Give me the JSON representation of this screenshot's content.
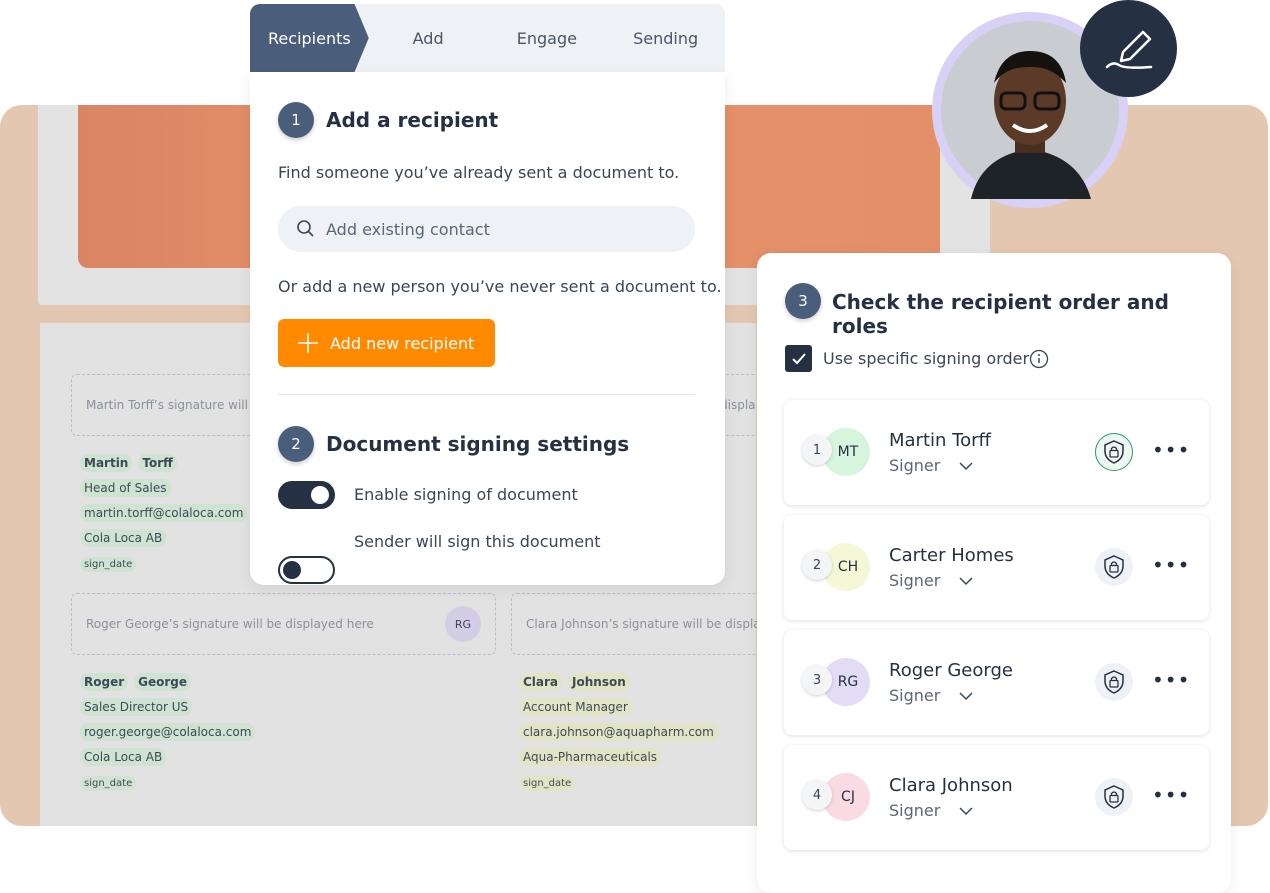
{
  "stepper": {
    "steps": [
      "Recipients",
      "Add",
      "Engage",
      "Sending"
    ],
    "active": 0
  },
  "section1": {
    "number": "1",
    "title": "Add a recipient",
    "desc": "Find someone you’ve already sent a document to.",
    "search_placeholder": "Add existing contact",
    "alt_desc": "Or add a new person you’ve never sent a document to.",
    "add_button": "Add new recipient"
  },
  "section2": {
    "number": "2",
    "title": "Document signing settings",
    "toggles": [
      {
        "label": "Enable signing of document",
        "on": true
      },
      {
        "label": "Sender will sign this document",
        "on": false
      }
    ]
  },
  "section3": {
    "number": "3",
    "title": "Check the recipient order and roles",
    "signing_order_label": "Use specific signing order",
    "signing_order_checked": true,
    "recipients": [
      {
        "order": "1",
        "initials": "MT",
        "name": "Martin Torff",
        "role": "Signer",
        "avatar_color": "#d6f5dc",
        "lock_active": true
      },
      {
        "order": "2",
        "initials": "CH",
        "name": "Carter Homes",
        "role": "Signer",
        "avatar_color": "#f4f8d6",
        "lock_active": false
      },
      {
        "order": "3",
        "initials": "RG",
        "name": "Roger George",
        "role": "Signer",
        "avatar_color": "#e3dcf7",
        "lock_active": false
      },
      {
        "order": "4",
        "initials": "CJ",
        "name": "Clara Johnson",
        "role": "Signer",
        "avatar_color": "#fadbe3",
        "lock_active": false
      }
    ]
  },
  "document": {
    "sig1": "Martin Torff’s signature will be displayed here",
    "sig1_right": "displa",
    "sig2": "Roger George’s signature will be displayed here",
    "sig2_initials": "RG",
    "sig3": "Clara Johnson’s signature will be displayed here",
    "martin": {
      "first": "Martin",
      "last": "Torff",
      "title": "Head of Sales",
      "email": "martin.torff@colaloca.com",
      "company": "Cola Loca AB",
      "date": "sign_date"
    },
    "roger": {
      "first": "Roger",
      "last": "George",
      "title": "Sales Director US",
      "email": "roger.george@colaloca.com",
      "company": "Cola Loca AB",
      "date": "sign_date"
    },
    "clara": {
      "first": "Clara",
      "last": "Johnson",
      "title": "Account Manager",
      "email": "clara.johnson@aquapharm.com",
      "company": "Aqua-Pharmaceuticals",
      "date": "sign_date"
    }
  },
  "colors": {
    "accent": "#ff8a00",
    "primary": "#253142",
    "step_active": "#4a5d7a"
  }
}
